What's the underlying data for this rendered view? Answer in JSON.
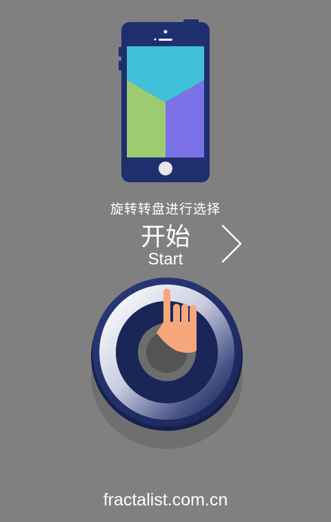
{
  "instruction": {
    "text": "旋转转盘进行选择"
  },
  "start": {
    "label_zh": "开始",
    "label_en": "Start"
  },
  "footer": {
    "site": "fractalist.com.cn"
  },
  "colors": {
    "background": "#808080",
    "phone_body": "#1f2f6e",
    "screen_top": "#41c1d9",
    "screen_left": "#9ccb72",
    "screen_right": "#7b72e8",
    "dial_navy": "#1a2558",
    "hand": "#f6a77b"
  },
  "icons": {
    "phone": "smartphone-illustration",
    "next": "chevron-right-icon",
    "dial": "rotary-dial-icon",
    "hand": "pointing-hand-icon"
  }
}
